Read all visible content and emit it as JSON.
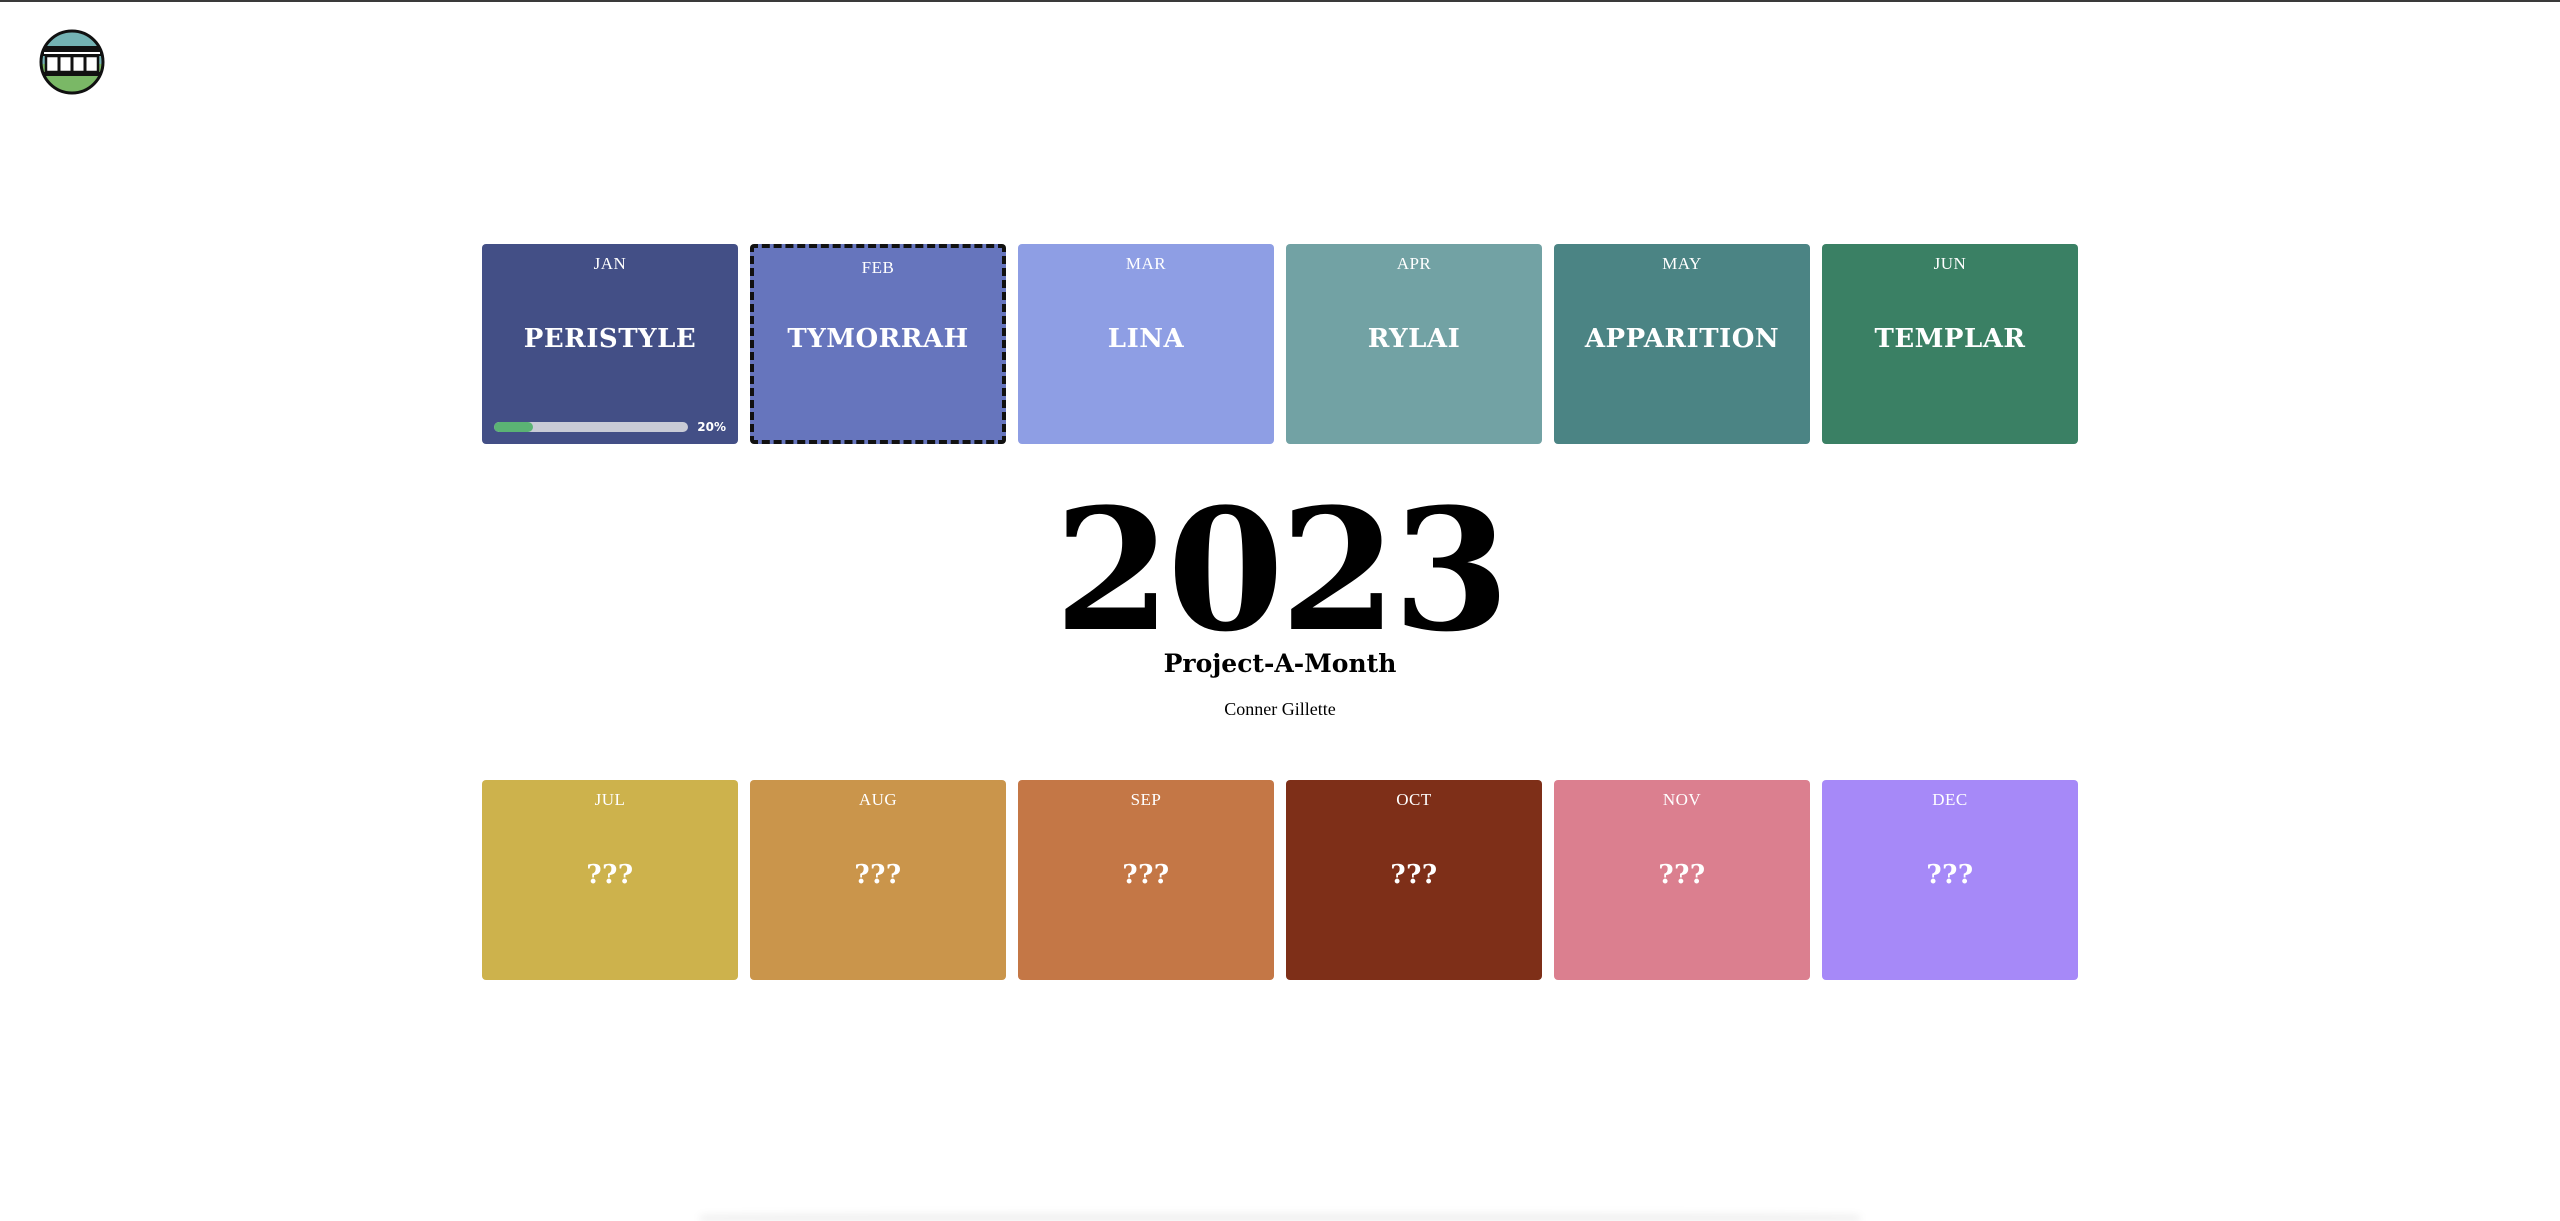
{
  "header": {
    "logo_icon": "temple-columns-icon"
  },
  "top_row": [
    {
      "month": "JAN",
      "name": "PERISTYLE",
      "color": "#434f86",
      "progress": 20,
      "progress_label": "20%"
    },
    {
      "month": "FEB",
      "name": "TYMORRAH",
      "color": "#6675bd",
      "selected": true
    },
    {
      "month": "MAR",
      "name": "LINA",
      "color": "#8e9ee4"
    },
    {
      "month": "APR",
      "name": "RYLAI",
      "color": "#72a2a4"
    },
    {
      "month": "MAY",
      "name": "APPARITION",
      "color": "#4b8484"
    },
    {
      "month": "JUN",
      "name": "TEMPLAR",
      "color": "#3a8064"
    }
  ],
  "center": {
    "year": "2023",
    "subtitle": "Project-A-Month",
    "author": "Conner Gillette"
  },
  "bottom_row": [
    {
      "month": "JUL",
      "name": "???",
      "color": "#cdb24c"
    },
    {
      "month": "AUG",
      "name": "???",
      "color": "#ca954b"
    },
    {
      "month": "SEP",
      "name": "???",
      "color": "#c47746"
    },
    {
      "month": "OCT",
      "name": "???",
      "color": "#7e2f18"
    },
    {
      "month": "NOV",
      "name": "???",
      "color": "#db7f8f"
    },
    {
      "month": "DEC",
      "name": "???",
      "color": "#a689f8"
    }
  ]
}
